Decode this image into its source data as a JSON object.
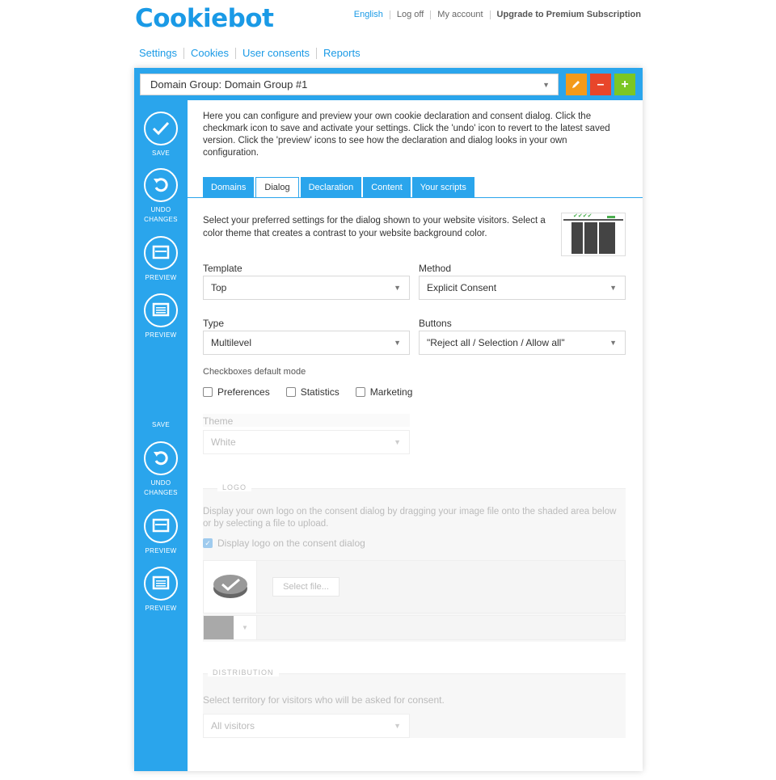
{
  "brand": {
    "logo_text": "Cookiebot"
  },
  "toplinks": {
    "language": "English",
    "log_off": "Log off",
    "my_account": "My account",
    "upgrade": "Upgrade to Premium Subscription"
  },
  "nav": {
    "settings": "Settings",
    "cookies": "Cookies",
    "user_consents": "User consents",
    "reports": "Reports"
  },
  "domain_group": {
    "selected": "Domain Group: Domain Group #1"
  },
  "sidebar": {
    "save": "SAVE",
    "undo_line1": "UNDO",
    "undo_line2": "CHANGES",
    "preview": "PREVIEW",
    "preview2": "PREVIEW",
    "save_lower": "SAVE",
    "undo_lower_line1": "UNDO",
    "undo_lower_line2": "CHANGES",
    "preview_lower": "PREVIEW",
    "preview_lower2": "PREVIEW"
  },
  "intro_text": "Here you can configure and preview your own cookie declaration and consent dialog. Click the checkmark icon to save and activate your settings. Click the 'undo' icon to revert to the latest saved version. Click the 'preview' icons to see how the declaration and dialog looks in your own configuration.",
  "tabs": [
    "Domains",
    "Dialog",
    "Declaration",
    "Content",
    "Your scripts"
  ],
  "dialog": {
    "description": "Select your preferred settings for the dialog shown to your website visitors. Select a color theme that creates a contrast to your website background color.",
    "template_label": "Template",
    "template_value": "Top",
    "method_label": "Method",
    "method_value": "Explicit Consent",
    "type_label": "Type",
    "type_value": "Multilevel",
    "buttons_label": "Buttons",
    "buttons_value": "\"Reject all / Selection / Allow all\"",
    "checkbox_mode_label": "Checkboxes default mode",
    "checkbox_preferences": "Preferences",
    "checkbox_statistics": "Statistics",
    "checkbox_marketing": "Marketing",
    "theme_label": "Theme",
    "theme_value": "White"
  },
  "logo_section": {
    "legend": "LOGO",
    "description": "Display your own logo on the consent dialog by dragging your image file onto the shaded area below or by selecting a file to upload.",
    "display_logo_label": "Display logo on the consent dialog",
    "select_file": "Select file..."
  },
  "distribution": {
    "legend": "DISTRIBUTION",
    "description": "Select territory for visitors who will be asked for consent.",
    "value": "All visitors"
  },
  "colors": {
    "accent": "#2aa5ec",
    "edit": "#f39a1a",
    "remove": "#e8462a",
    "add": "#7cc624"
  }
}
